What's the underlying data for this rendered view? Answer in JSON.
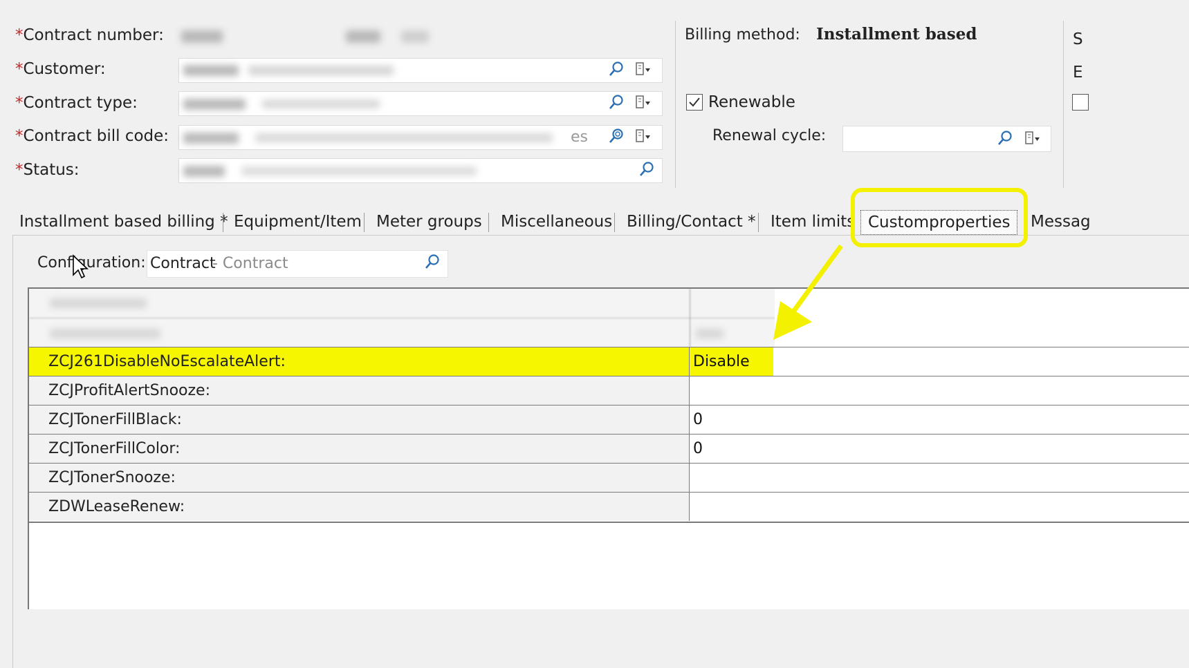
{
  "header": {
    "contract_number_label": "Contract number:",
    "customer_label": "Customer:",
    "contract_type_label": "Contract type:",
    "contract_bill_code_label": "Contract bill code:",
    "status_label": "Status:",
    "required_mark": "*",
    "bill_code_suffix": "es",
    "billing_method_label": "Billing method:",
    "billing_method_value": "Installment based",
    "renewable_label": "Renewable",
    "renewal_cycle_label": "Renewal cycle:",
    "right_col_label_1": "S",
    "right_col_label_2": "E"
  },
  "tabs": [
    {
      "label": "Installment based billing *"
    },
    {
      "label": "Equipment/Item"
    },
    {
      "label": "Meter groups"
    },
    {
      "label": "Miscellaneous"
    },
    {
      "label": "Billing/Contact *"
    },
    {
      "label": "Item limits"
    },
    {
      "label": "Customproperties"
    },
    {
      "label": "Messag"
    }
  ],
  "configuration": {
    "label": "Configuration:",
    "value": "Contract",
    "value_desc": "- Contract"
  },
  "properties": [
    {
      "name": "ZCJ261DisableNoEscalateAlert:",
      "value": "Disable"
    },
    {
      "name": "ZCJProfitAlertSnooze:",
      "value": ""
    },
    {
      "name": "ZCJTonerFillBlack:",
      "value": "0"
    },
    {
      "name": "ZCJTonerFillColor:",
      "value": "0"
    },
    {
      "name": "ZCJTonerSnooze:",
      "value": ""
    },
    {
      "name": "ZDWLeaseRenew:",
      "value": ""
    }
  ],
  "annotation_color": "#f6f600"
}
